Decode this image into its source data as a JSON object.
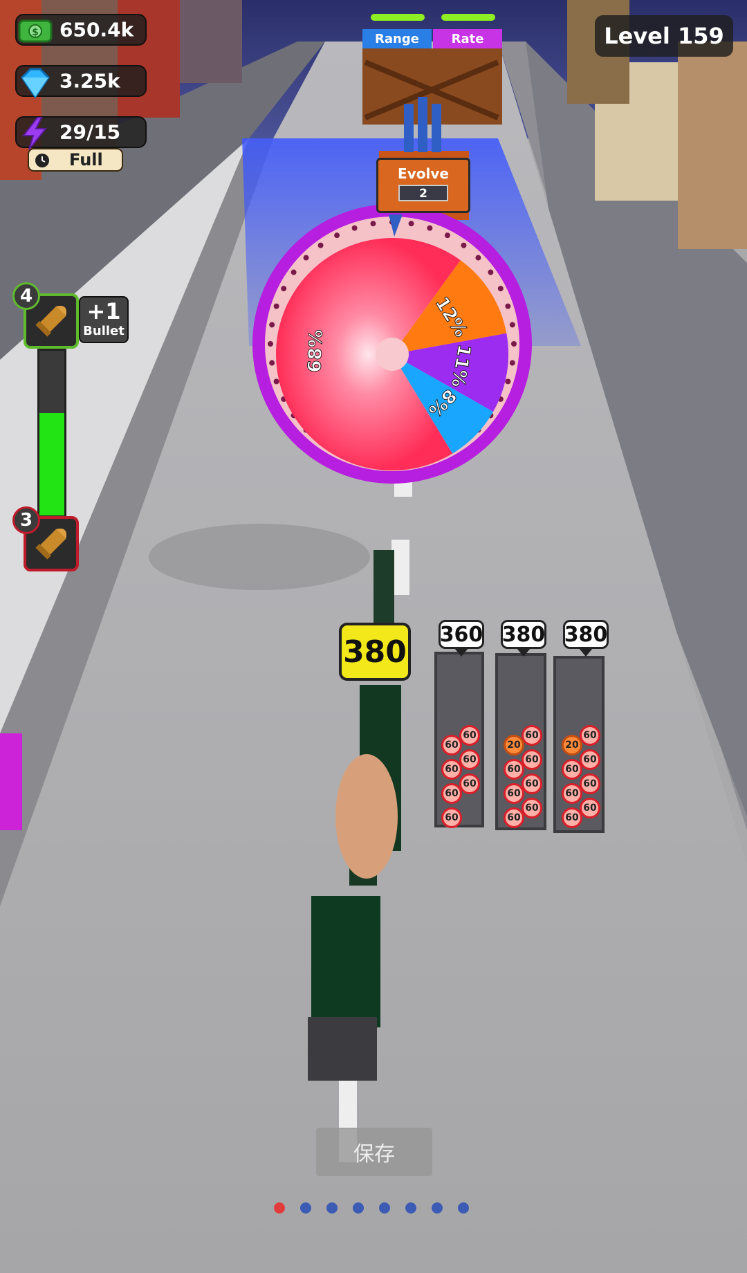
{
  "hud": {
    "cash": "650.4k",
    "gems": "3.25k",
    "energy": "29/15",
    "energy_status": "Full",
    "level": "Level 159"
  },
  "bullet_panel": {
    "next_level": "4",
    "bonus": "+1",
    "bonus_label": "Bullet",
    "current_level": "3",
    "progress_fraction": 0.62
  },
  "gates": {
    "left_label": "Range",
    "right_label": "Rate",
    "evolve_label": "Evolve",
    "evolve_count": "2"
  },
  "wheel": {
    "segments": [
      {
        "label": "68%",
        "value": 68,
        "color": "#ff3a63"
      },
      {
        "label": "12%",
        "value": 12,
        "color": "#ff7a10"
      },
      {
        "label": "11%",
        "value": 11,
        "color": "#9b2cf0"
      },
      {
        "label": "8%",
        "value": 8,
        "color": "#18a6ff"
      }
    ]
  },
  "gun": {
    "value": "380"
  },
  "ammo_tubes": [
    {
      "value": "360",
      "chips": [
        "60",
        "60",
        "60",
        "60",
        "60",
        "60",
        "60"
      ]
    },
    {
      "value": "380",
      "chips": [
        "20",
        "60",
        "60",
        "60",
        "60",
        "60",
        "60",
        "60"
      ]
    },
    {
      "value": "380",
      "chips": [
        "20",
        "60",
        "60",
        "60",
        "60",
        "60",
        "60",
        "60"
      ]
    }
  ],
  "save_button": "保存",
  "pagination": {
    "count": 8,
    "active_index": 0
  },
  "colors": {
    "cash_green": "#3fb53f",
    "gem_blue": "#2fb6ff",
    "energy_purple": "#9b3cf0",
    "progress_green": "#22e414",
    "gun_tag_yellow": "#f3e81a"
  }
}
